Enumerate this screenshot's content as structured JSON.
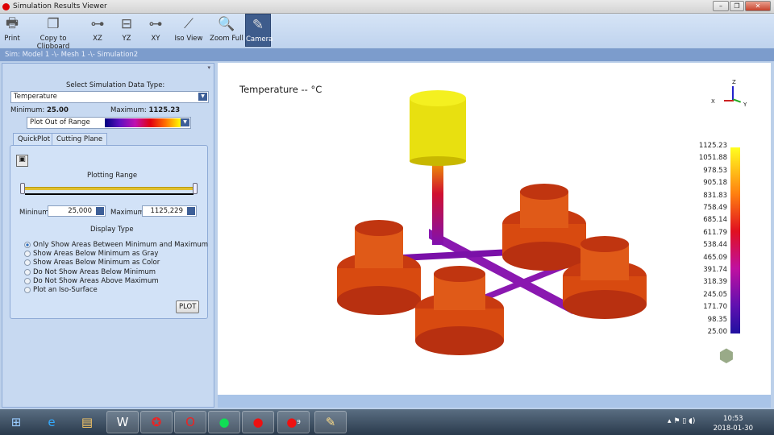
{
  "window": {
    "title": "Simulation Results Viewer"
  },
  "toolbar": [
    {
      "label": "Print",
      "icon": "printer-icon",
      "glyph": "🖶"
    },
    {
      "label": "Copy to Clipboard",
      "icon": "clipboard-icon",
      "glyph": "❐"
    },
    {
      "label": "XZ",
      "icon": "xz-view-icon",
      "glyph": "⊶"
    },
    {
      "label": "YZ",
      "icon": "yz-view-icon",
      "glyph": "⊟"
    },
    {
      "label": "XY",
      "icon": "xy-view-icon",
      "glyph": "⊶"
    },
    {
      "label": "Iso View",
      "icon": "iso-view-icon",
      "glyph": "⟋"
    },
    {
      "label": "Zoom Full",
      "icon": "magnifier-icon",
      "glyph": "🔍"
    },
    {
      "label": "Camera",
      "icon": "camera-icon",
      "glyph": "✎"
    }
  ],
  "breadcrumb": "Sim: Model 1 -\\- Mesh 1 -\\- Simulation2",
  "panel": {
    "select_label": "Select Simulation Data Type:",
    "data_type": "Temperature",
    "min_label": "Minimum:",
    "min_value": "25.00",
    "max_label": "Maximum:",
    "max_value": "1125.23",
    "palette": "Plot Out of Range",
    "tabs": [
      "QuickPlot",
      "Cutting Plane"
    ],
    "plotting_range": "Plotting Range",
    "min_field_label": "Mininum",
    "min_field": "25,000",
    "max_field_label": "Maximum",
    "max_field": "1125,229",
    "display_type": "Display Type",
    "options": [
      "Only Show Areas Between Minimum and Maximum",
      "Show Areas Below Minimum as Gray",
      "Show Areas Below Minimum as Color",
      "Do Not Show Areas Below Minimum",
      "Do Not Show Areas Above Maximum",
      "Plot an Iso-Surface"
    ],
    "selected_option": 0,
    "plot_button": "PLOT"
  },
  "view": {
    "title": "Temperature  --   °C",
    "axes": {
      "x": "X",
      "y": "Y",
      "z": "Z"
    },
    "legend": [
      "1125.23",
      "1051.88",
      "978.53",
      "905.18",
      "831.83",
      "758.49",
      "685.14",
      "611.79",
      "538.44",
      "465.09",
      "391.74",
      "318.39",
      "245.05",
      "171.70",
      "98.35",
      "25.00"
    ]
  },
  "taskbar": {
    "time": "10:53",
    "date": "2018-01-30",
    "badge": "9"
  }
}
